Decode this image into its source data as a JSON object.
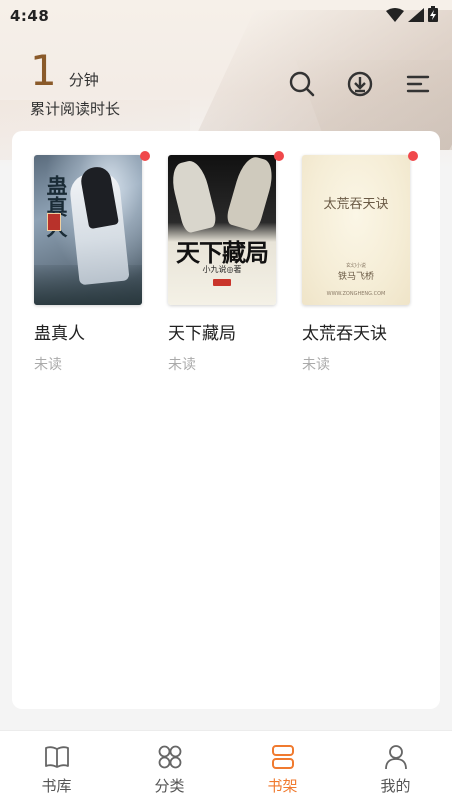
{
  "status_bar": {
    "time": "4:48",
    "icons": [
      "wifi-icon",
      "signal-icon",
      "battery-charging-icon"
    ]
  },
  "reading": {
    "minutes": "1",
    "unit": "分钟",
    "caption": "累计阅读时长"
  },
  "header_actions": [
    "search-icon",
    "download-icon",
    "menu-icon"
  ],
  "accent_color": "#f07a2f",
  "books": [
    {
      "title": "蛊真人",
      "status": "未读",
      "unread_dot": true,
      "cover": {
        "title": "蛊真人"
      }
    },
    {
      "title": "天下藏局",
      "status": "未读",
      "unread_dot": true,
      "cover": {
        "title": "天下藏局",
        "author": "小九说◎著"
      }
    },
    {
      "title": "太荒吞天诀",
      "status": "未读",
      "unread_dot": true,
      "cover": {
        "title": "太荒吞天诀",
        "small": "玄幻小说",
        "author": "铁马飞桥",
        "site": "WWW.ZONGHENG.COM"
      }
    }
  ],
  "nav": [
    {
      "label": "书库",
      "icon": "book-open-icon",
      "active": false
    },
    {
      "label": "分类",
      "icon": "category-grid-icon",
      "active": false
    },
    {
      "label": "书架",
      "icon": "bookshelf-icon",
      "active": true
    },
    {
      "label": "我的",
      "icon": "user-icon",
      "active": false
    }
  ]
}
